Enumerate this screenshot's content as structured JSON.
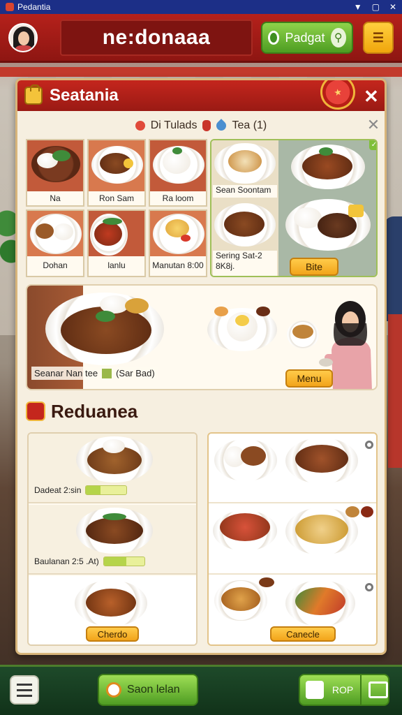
{
  "status_bar": {
    "app_name": "Pedantia"
  },
  "top_bar": {
    "title": "ne:donaaa",
    "green_button_label": "Padgat"
  },
  "panel": {
    "title": "Seatania",
    "filters": {
      "label_a": "Di Tulads",
      "label_b": "Tea (1)"
    },
    "grid_items": [
      {
        "label": "Na"
      },
      {
        "label": "Ron Sam"
      },
      {
        "label": "Ra loom"
      },
      {
        "label": "Dohan"
      },
      {
        "label": "lanlu"
      },
      {
        "label": "Manutan 8:00"
      }
    ],
    "featured": {
      "label_top": "Sean Soontam",
      "label_bottom": "Sering Sat-2 8K8j.",
      "button_label": "Bite"
    },
    "banner": {
      "caption_left": "Seanar Nan tee",
      "caption_right": "(Sar Bad)",
      "menu_button": "Menu"
    },
    "section": {
      "title": "Reduanea"
    },
    "left_list": [
      {
        "caption": "Dadeat 2:sin",
        "progress": 0.35
      },
      {
        "caption": "Baulanan 2:5 .At)",
        "progress": 0.55
      },
      {
        "caption": "",
        "button_label": "Cherdo"
      }
    ],
    "right_list": {
      "button_label": "Canecle"
    }
  },
  "bottom_bar": {
    "main_button_label": "Saon lelan",
    "right_button_label": "ROP"
  }
}
